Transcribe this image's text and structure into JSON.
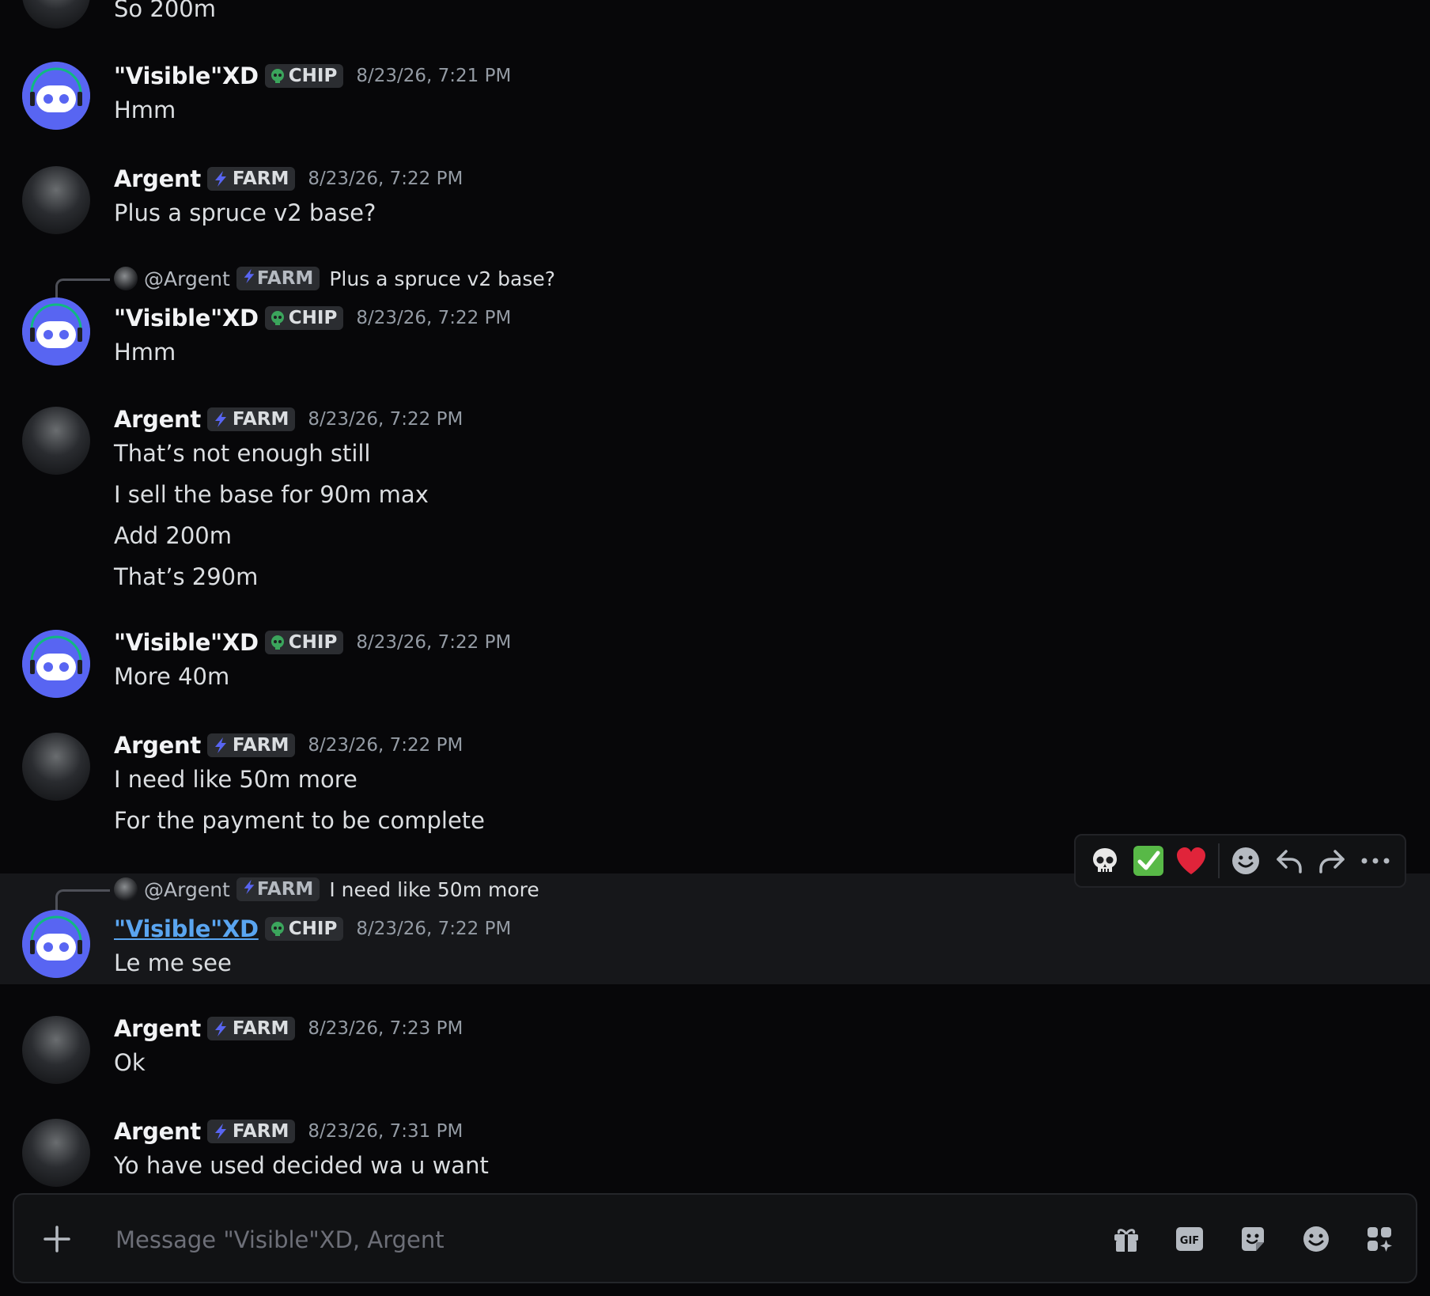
{
  "messages": [
    {
      "lines": [
        "So 200m"
      ]
    },
    {
      "author": "\"Visible\"XD",
      "tag": "CHIP",
      "time": "8/23/26, 7:21 PM",
      "lines": [
        "Hmm"
      ]
    },
    {
      "author": "Argent",
      "tag": "FARM",
      "time": "8/23/26, 7:22 PM",
      "lines": [
        "Plus a spruce v2 base?"
      ]
    },
    {
      "reply": {
        "user": "@Argent",
        "tag": "FARM",
        "text": "Plus a spruce v2 base?"
      },
      "author": "\"Visible\"XD",
      "tag": "CHIP",
      "time": "8/23/26, 7:22 PM",
      "lines": [
        "Hmm"
      ]
    },
    {
      "author": "Argent",
      "tag": "FARM",
      "time": "8/23/26, 7:22 PM",
      "lines": [
        "That’s not enough still",
        "I sell the base for 90m max",
        "Add 200m",
        "That’s 290m"
      ]
    },
    {
      "author": "\"Visible\"XD",
      "tag": "CHIP",
      "time": "8/23/26, 7:22 PM",
      "lines": [
        "More 40m"
      ]
    },
    {
      "author": "Argent",
      "tag": "FARM",
      "time": "8/23/26, 7:22 PM",
      "lines": [
        "I need like 50m more",
        "For the payment to be complete"
      ]
    },
    {
      "reply": {
        "user": "@Argent",
        "tag": "FARM",
        "text": "I need like 50m more"
      },
      "author": "\"Visible\"XD",
      "tag": "CHIP",
      "time": "8/23/26, 7:22 PM",
      "lines": [
        "Le me see"
      ]
    },
    {
      "author": "Argent",
      "tag": "FARM",
      "time": "8/23/26, 7:23 PM",
      "lines": [
        "Ok"
      ]
    },
    {
      "author": "Argent",
      "tag": "FARM",
      "time": "8/23/26, 7:31 PM",
      "lines": [
        "Yo have used decided wa u want"
      ]
    }
  ],
  "toolbar": {
    "icons": [
      "skull-emoji-icon",
      "check-mark-emoji-icon",
      "heart-emoji-icon",
      "add-reaction-icon",
      "reply-icon",
      "forward-icon",
      "more-icon"
    ]
  },
  "composer": {
    "placeholder": "Message \"Visible\"XD, Argent",
    "icons": [
      "gift-icon",
      "gif-icon",
      "sticker-icon",
      "emoji-icon",
      "apps-icon"
    ]
  },
  "colors": {
    "chip_icon": "#3ba55c",
    "farm_icon": "#5865f2",
    "background": "#070709",
    "highlight": "#16171a"
  }
}
